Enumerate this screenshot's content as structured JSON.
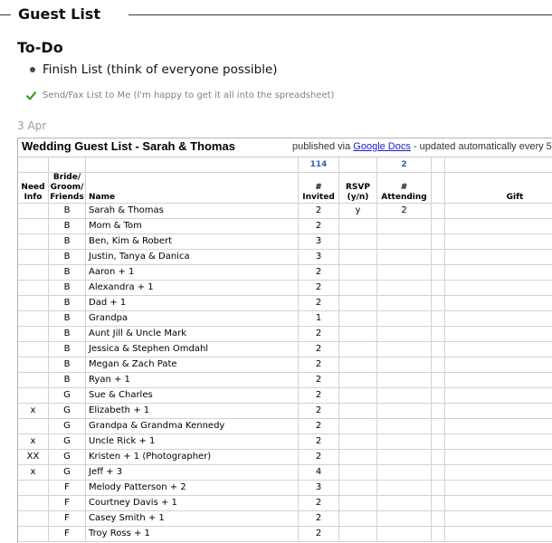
{
  "page": {
    "title": "Guest List"
  },
  "todo": {
    "heading": "To-Do",
    "open_items": [
      {
        "text": "Finish List (think of everyone possible)"
      }
    ],
    "completed_items": [
      {
        "text": "Send/Fax List to Me (I'm happy to get it all into the spreadsheet)",
        "icon": "checkmark-icon"
      }
    ]
  },
  "post": {
    "date": "3 Apr"
  },
  "sheet": {
    "title": "Wedding Guest List - Sarah & Thomas",
    "published": {
      "prefix": "published via",
      "link": "Google Docs",
      "suffix": "- updated automatically every 5"
    },
    "totals": {
      "invited": 114,
      "attending": 2
    },
    "headers": {
      "need_info": [
        "Need",
        "Info"
      ],
      "side": [
        "Bride/",
        "Groom/",
        "Friends"
      ],
      "name": [
        "Name"
      ],
      "invited": [
        "#",
        "Invited"
      ],
      "rsvp": [
        "RSVP",
        "(y/n)"
      ],
      "attending": [
        "#",
        "Attending"
      ],
      "gift": [
        "Gift"
      ]
    },
    "rows": [
      {
        "side": "B",
        "name": "Sarah & Thomas",
        "invited": 2,
        "rsvp": "y",
        "attending": 2
      },
      {
        "side": "B",
        "name": "Mom & Tom",
        "invited": 2
      },
      {
        "side": "B",
        "name": "Ben, Kim & Robert",
        "invited": 3
      },
      {
        "side": "B",
        "name": "Justin, Tanya & Danica",
        "invited": 3
      },
      {
        "side": "B",
        "name": "Aaron + 1",
        "invited": 2
      },
      {
        "side": "B",
        "name": "Alexandra + 1",
        "invited": 2
      },
      {
        "side": "B",
        "name": "Dad + 1",
        "invited": 2
      },
      {
        "side": "B",
        "name": "Grandpa",
        "invited": 1
      },
      {
        "side": "B",
        "name": "Aunt Jill & Uncle Mark",
        "invited": 2
      },
      {
        "side": "B",
        "name": "Jessica & Stephen Omdahl",
        "invited": 2
      },
      {
        "side": "B",
        "name": "Megan & Zach Pate",
        "invited": 2
      },
      {
        "side": "B",
        "name": "Ryan + 1",
        "invited": 2
      },
      {
        "side": "G",
        "name": "Sue & Charles",
        "invited": 2
      },
      {
        "need": "x",
        "side": "G",
        "name": "Elizabeth + 1",
        "invited": 2
      },
      {
        "side": "G",
        "name": "Grandpa & Grandma Kennedy",
        "invited": 2
      },
      {
        "need": "x",
        "side": "G",
        "name": "Uncle Rick + 1",
        "invited": 2
      },
      {
        "need": "XX",
        "side": "G",
        "name": "Kristen + 1 (Photographer)",
        "invited": 2
      },
      {
        "need": "x",
        "side": "G",
        "name": "Jeff + 3",
        "invited": 4
      },
      {
        "side": "F",
        "name": "Melody Patterson + 2",
        "invited": 3
      },
      {
        "side": "F",
        "name": "Courtney Davis + 1",
        "invited": 2
      },
      {
        "side": "F",
        "name": "Casey Smith + 1",
        "invited": 2
      },
      {
        "side": "F",
        "name": "Troy Ross + 1",
        "invited": 2
      }
    ]
  },
  "colors": {
    "check": "#3d9a1f",
    "link": "#1c1cc8",
    "totals": "#3b5bb5",
    "grid": "#d2d2d2"
  }
}
